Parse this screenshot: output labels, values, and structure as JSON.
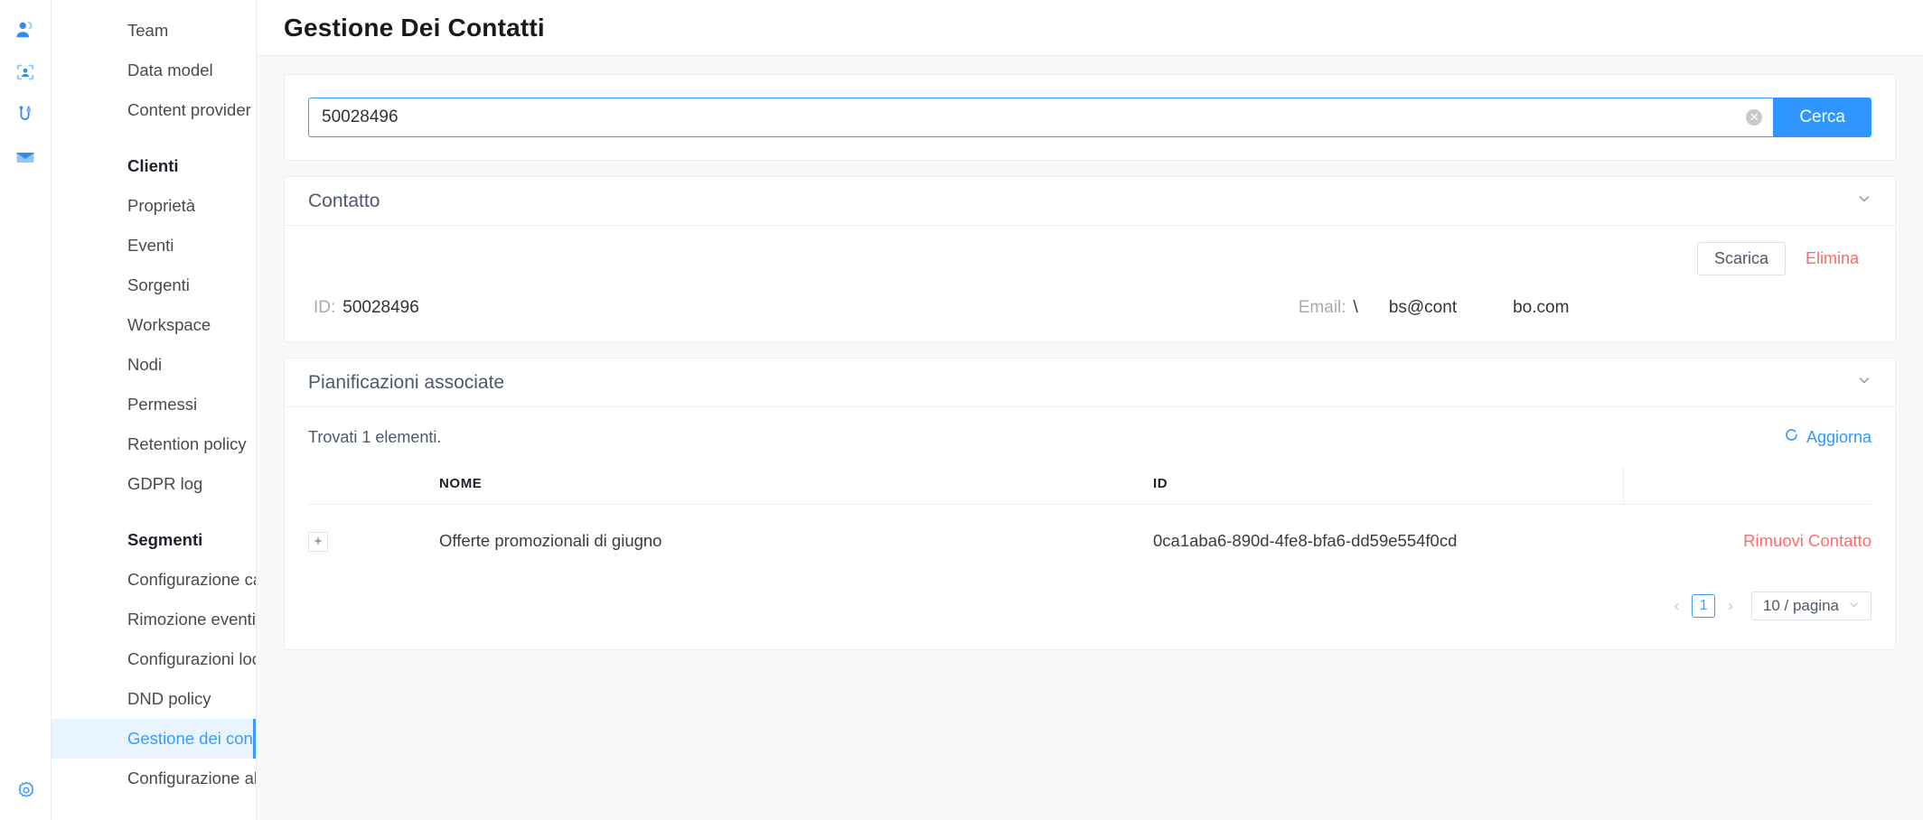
{
  "rail": {
    "icons": [
      {
        "name": "team-people-icon"
      },
      {
        "name": "face-scan-icon"
      },
      {
        "name": "contact-link-icon"
      },
      {
        "name": "envelope-icon"
      }
    ],
    "bottom_icon": {
      "name": "gear-icon"
    }
  },
  "sidebar": {
    "items": [
      {
        "label": "Team",
        "type": "item",
        "active": false
      },
      {
        "label": "Data model",
        "type": "item",
        "active": false
      },
      {
        "label": "Content provider",
        "type": "item",
        "active": false
      },
      {
        "label": "Clienti",
        "type": "group",
        "active": false
      },
      {
        "label": "Proprietà",
        "type": "item",
        "active": false
      },
      {
        "label": "Eventi",
        "type": "item",
        "active": false
      },
      {
        "label": "Sorgenti",
        "type": "item",
        "active": false
      },
      {
        "label": "Workspace",
        "type": "item",
        "active": false
      },
      {
        "label": "Nodi",
        "type": "item",
        "active": false
      },
      {
        "label": "Permessi",
        "type": "item",
        "active": false
      },
      {
        "label": "Retention policy",
        "type": "item",
        "active": false
      },
      {
        "label": "GDPR log",
        "type": "item",
        "active": false
      },
      {
        "label": "Segmenti",
        "type": "group",
        "active": false
      },
      {
        "label": "Configurazione campi",
        "type": "item",
        "active": false
      },
      {
        "label": "Rimozione eventi",
        "type": "item",
        "active": false
      },
      {
        "label": "Configurazioni locali",
        "type": "item",
        "active": false
      },
      {
        "label": "DND policy",
        "type": "item",
        "active": false
      },
      {
        "label": "Gestione dei contatti",
        "type": "item",
        "active": true
      },
      {
        "label": "Configurazione alert",
        "type": "item",
        "active": false
      }
    ]
  },
  "header": {
    "title": "Gestione Dei Contatti"
  },
  "search": {
    "value": "50028496",
    "placeholder": "",
    "clear_icon": "clear-circle-icon",
    "button_label": "Cerca"
  },
  "contact_panel": {
    "title": "Contatto",
    "collapse_icon": "chevron-down-icon",
    "download_label": "Scarica",
    "delete_label": "Elimina",
    "id_label": "ID:",
    "id_value": "50028496",
    "email_label": "Email:",
    "email_prefix": "\\",
    "email_mid": "bs@cont",
    "email_suffix": "bo.com"
  },
  "schedules_panel": {
    "title": "Pianificazioni associate",
    "collapse_icon": "chevron-down-icon",
    "found_text": "Trovati 1 elementi.",
    "refresh_icon": "refresh-icon",
    "refresh_label": "Aggiorna",
    "columns": [
      "",
      "NOME",
      "ID",
      ""
    ],
    "rows": [
      {
        "expander": "+",
        "nome": "Offerte promozionali di giugno",
        "id": "0ca1aba6-890d-4fe8-bfa6-dd59e554f0cd",
        "action": "Rimuovi Contatto"
      }
    ],
    "pagination": {
      "prev_icon": "chevron-left-icon",
      "next_icon": "chevron-right-icon",
      "current_page": "1",
      "page_size_label": "10 / pagina",
      "page_size_icon": "chevron-down-icon"
    }
  },
  "colors": {
    "accent": "#2f96ff",
    "accent_light": "#3d9bfc",
    "danger": "#ff6b6b",
    "danger_text": "#f56c6c",
    "page_bg": "#f7f8fa",
    "border": "#ebedf0"
  }
}
